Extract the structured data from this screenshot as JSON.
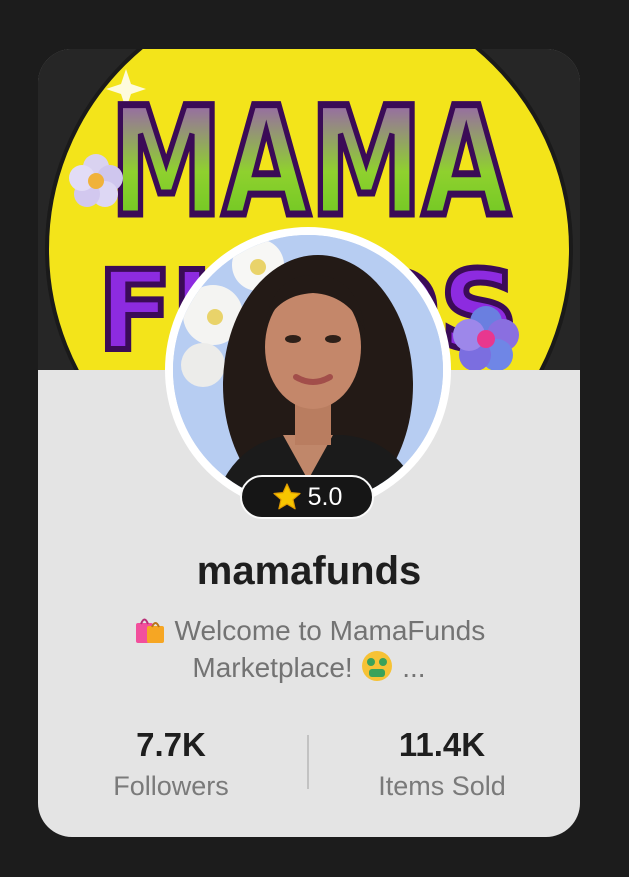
{
  "banner": {
    "logo_text_top": "MAMA",
    "logo_text_bottom": "FUNDS"
  },
  "profile": {
    "rating": "5.0",
    "username": "mamafunds",
    "bio_line1": "Welcome to MamaFunds",
    "bio_line2": "Marketplace!",
    "bio_ellipsis": "..."
  },
  "stats": [
    {
      "value": "7.7K",
      "label": "Followers"
    },
    {
      "value": "11.4K",
      "label": "Items Sold"
    }
  ],
  "colors": {
    "page_background": "#1c1c1c",
    "card_background": "#e4e4e4",
    "banner_yellow": "#f3e41a",
    "banner_purple": "#7a2bd0",
    "banner_green": "#7fd12b",
    "rating_badge": "#161616",
    "star": "#f7c600"
  },
  "icons": [
    "shopping-bags-emoji",
    "money-mouth-face-emoji",
    "star-icon"
  ]
}
